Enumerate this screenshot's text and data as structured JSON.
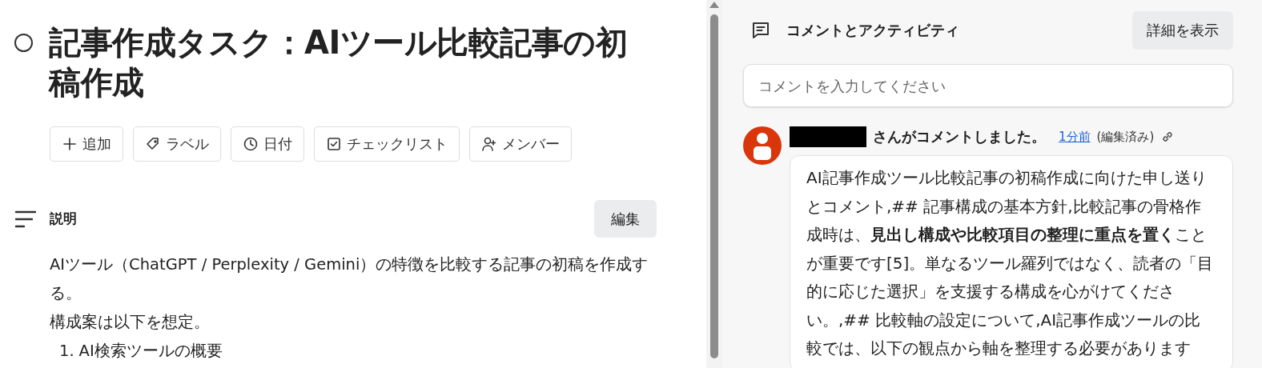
{
  "task": {
    "completed": false,
    "title": "記事作成タスク：AIツール比較記事の初稿作成"
  },
  "actions": [
    {
      "label": "追加"
    },
    {
      "label": "ラベル"
    },
    {
      "label": "日付"
    },
    {
      "label": "チェックリスト"
    },
    {
      "label": "メンバー"
    }
  ],
  "description": {
    "heading": "説明",
    "edit_button": "編集",
    "paragraphs": [
      "AIツール（ChatGPT / Perplexity / Gemini）の特徴を比較する記事の初稿を作成する。",
      "構成案は以下を想定。"
    ],
    "list": [
      {
        "number": "1.",
        "text": "AI検索ツールの概要"
      }
    ]
  },
  "activity": {
    "heading": "コメントとアクティビティ",
    "details_button": "詳細を表示",
    "comment_placeholder": "コメントを入力してください",
    "comments": [
      {
        "author_redacted": true,
        "action": "さんがコメントしました。",
        "time": "1分前",
        "edited": "(編集済み)",
        "body": "AI記事作成ツール比較記事の初稿作成に向けた申し送りとコメント,## 記事構成の基本方針,比較記事の骨格作成時は、**見出し構成や比較項目の整理に重点を置く**ことが重要です[5]。単なるツール羅列ではなく、読者の「目的に応じた選択」を支援する構成を心がけてください。,## 比較軸の設定について,AI記事作成ツールの比較では、以下の観点から軸を整理する必要があります"
      }
    ]
  }
}
